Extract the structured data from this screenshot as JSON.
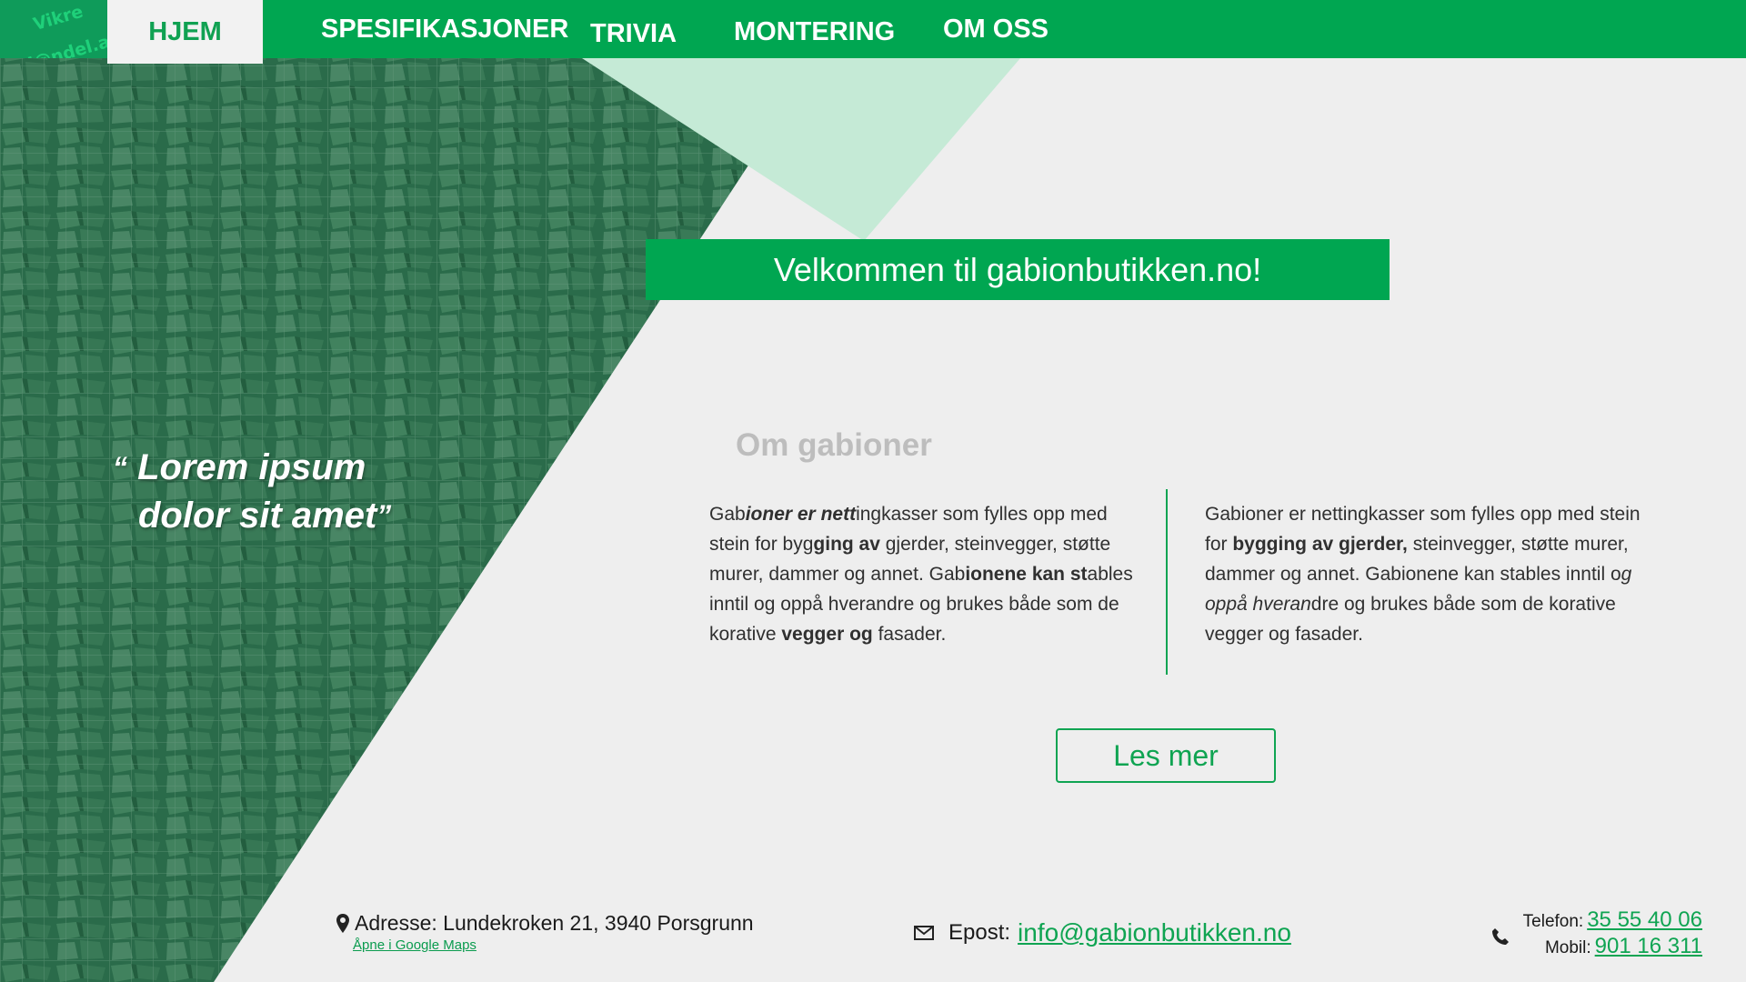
{
  "logo": {
    "line1": "Vikre",
    "line2": "H@ndel.as"
  },
  "nav": {
    "active": "HJEM",
    "items": [
      "SPESIFIKASJONER",
      "TRIVIA",
      "MONTERING",
      "OM OSS"
    ]
  },
  "hero": {
    "welcome": "Velkommen til gabionbutikken.no!",
    "quote_line1": "Lorem ipsum",
    "quote_line2": "dolor sit amet",
    "quote_open": "“",
    "quote_close": "”"
  },
  "about": {
    "title": "Om gabioner",
    "column1": {
      "p1": "Gab",
      "p2": "ioner er nett",
      "p3": "ingkasser som fylles opp med stein for byg",
      "p4": "ging av",
      "p5": " gjerder, steinvegger, støtte murer, dammer og annet. Gab",
      "p6": "ionene kan st",
      "p7": "ables inntil og oppå hverandre og brukes både som de korative ",
      "p8": "vegger og",
      "p9": " fasader."
    },
    "column2": {
      "p1": "Gabioner er nettingkasser som fylles opp med stein for ",
      "p2": "bygging av gjerder,",
      "p3": " steinvegger, støtte murer, dammer og annet. Gabionene kan stables inntil o",
      "p4": "g oppå hveran",
      "p5": "dre og brukes både som de korative vegger og fasader."
    },
    "read_more": "Les mer"
  },
  "footer": {
    "address": "Adresse: Lundekroken 21, 3940 Porsgrunn",
    "maps_link": "Åpne  i Google Maps",
    "email_label": "Epost:",
    "email": "info@gabionbutikken.no",
    "phone_label": "Telefon:",
    "phone": "35 55 40 06",
    "mobile_label": "Mobil:",
    "mobile": "901 16 311"
  },
  "colors": {
    "brand_green": "#00a651",
    "dark_green": "#0f9b5a",
    "light_mint": "#c5ead6",
    "background": "#eeeeee"
  },
  "icons": [
    "location-pin-icon",
    "mail-icon",
    "phone-icon"
  ]
}
